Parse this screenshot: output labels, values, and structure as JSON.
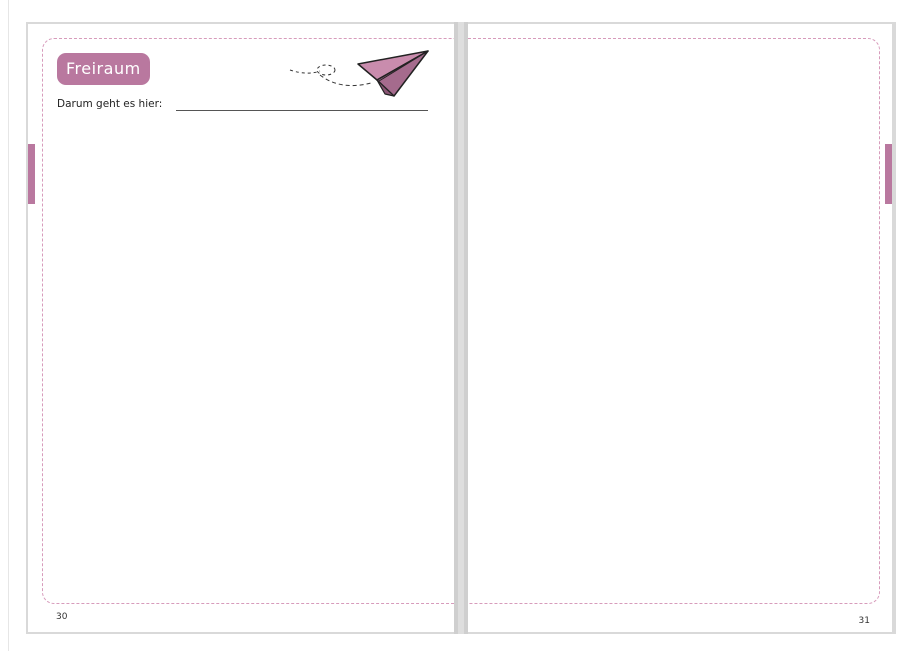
{
  "spread": {
    "left_page": {
      "title": "Freiraum",
      "subtitle": "Darum geht es hier:",
      "page_number": "30",
      "decoration_icon": "paper-plane-icon"
    },
    "right_page": {
      "page_number": "31"
    }
  },
  "colors": {
    "accent": "#b9789f",
    "frame_dash": "#d79bbb",
    "page_background": "#ffffff",
    "spread_border": "#d9d9d9"
  }
}
